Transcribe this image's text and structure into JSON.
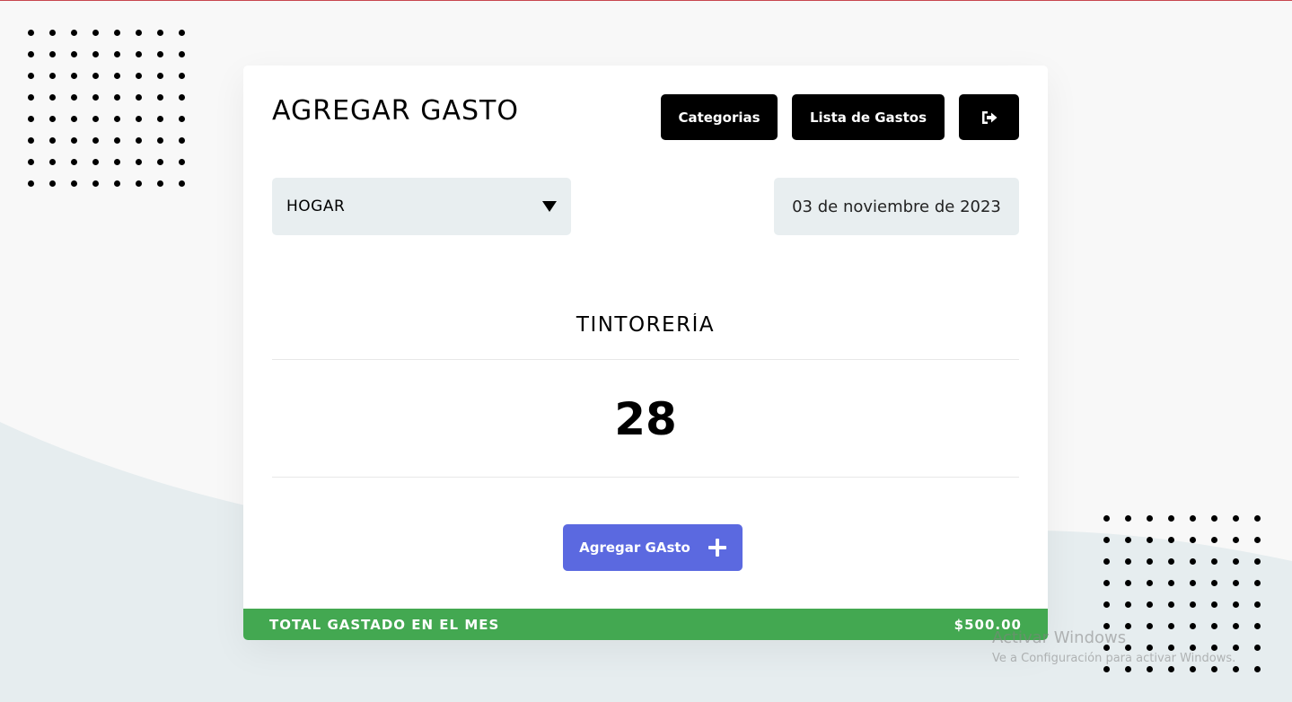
{
  "header": {
    "title": "AGREGAR GASTO",
    "categories_button": "Categorias",
    "list_button": "Lista de Gastos",
    "logout_icon": "sign-out-icon"
  },
  "form": {
    "category_selected": "HOGAR",
    "date": "03 de noviembre de 2023",
    "description": "TINTORERÍA",
    "amount": "28",
    "add_button": "Agregar GAsto",
    "add_icon": "plus-icon"
  },
  "footer": {
    "label": "TOTAL GASTADO EN EL MES",
    "total": "$500.00"
  },
  "watermark": {
    "title": "Activar Windows",
    "subtitle": "Ve a Configuración para activar Windows."
  },
  "colors": {
    "primary_button": "#5b69e0",
    "footer_green": "#43a851",
    "field_bg": "#e8eef0",
    "black_button": "#000000"
  }
}
